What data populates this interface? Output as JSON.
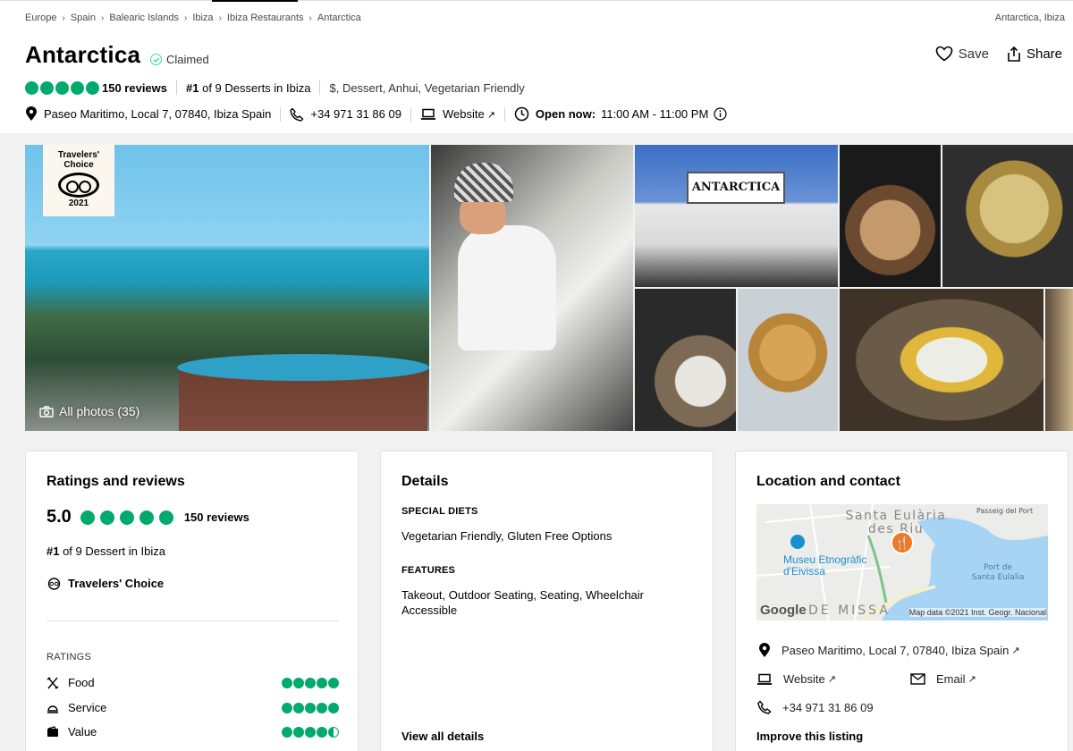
{
  "breadcrumbs": [
    "Europe",
    "Spain",
    "Balearic Islands",
    "Ibiza",
    "Ibiza Restaurants",
    "Antarctica"
  ],
  "breadcrumb_right": "Antarctica, Ibiza",
  "title": "Antarctica",
  "claimed_label": "Claimed",
  "actions": {
    "save": "Save",
    "share": "Share"
  },
  "summary": {
    "bubbles": 5,
    "reviews_label": "150 reviews",
    "rank_number": "#1",
    "rank_rest": " of 9 Desserts in Ibiza",
    "cuisines": "$, Dessert, Anhui, Vegetarian Friendly"
  },
  "contact_bar": {
    "address": "Paseo Maritimo, Local 7, 07840, Ibiza Spain",
    "phone": "+34 971 31 86 09",
    "website": "Website",
    "open_label": "Open now:",
    "hours": "11:00 AM - 11:00 PM"
  },
  "photos": {
    "badge_line1": "Travelers'",
    "badge_line2": "Choice",
    "badge_year": "2021",
    "storefront_sign": "ANTARCTICA",
    "all_photos": "All photos (35)"
  },
  "ratings_card": {
    "heading": "Ratings and reviews",
    "score": "5.0",
    "reviews": "150 reviews",
    "rank_number": "#1",
    "rank_rest": " of 9 Dessert in Ibiza",
    "travelers_choice": "Travelers' Choice",
    "ratings_label": "RATINGS",
    "rows": [
      {
        "label": "Food",
        "value": 5
      },
      {
        "label": "Service",
        "value": 5
      },
      {
        "label": "Value",
        "value": 4.5
      }
    ]
  },
  "details_card": {
    "heading": "Details",
    "special_diets_label": "SPECIAL DIETS",
    "special_diets": "Vegetarian Friendly, Gluten Free Options",
    "features_label": "FEATURES",
    "features": "Takeout, Outdoor Seating, Seating, Wheelchair Accessible",
    "view_all": "View all details"
  },
  "location_card": {
    "heading": "Location and contact",
    "map": {
      "label_town": "Santa Eulària des Riu",
      "label_passeig": "Passeig del Port",
      "label_museum": "Museu Etnogràfic d'Eivissa",
      "label_port": "Port de Santa Eulalia",
      "label_missa": "DE MISSA",
      "google": "Google",
      "copyright": "Map data ©2021 Inst. Geogr. Nacional"
    },
    "address": "Paseo Maritimo, Local 7, 07840, Ibiza Spain",
    "website": "Website",
    "email": "Email",
    "phone": "+34 971 31 86 09",
    "improve": "Improve this listing"
  },
  "colors": {
    "bubble": "#00aa6c",
    "claimed": "#34e0a1",
    "map_pin": "#f07922",
    "map_sea": "#a7d4f4"
  }
}
